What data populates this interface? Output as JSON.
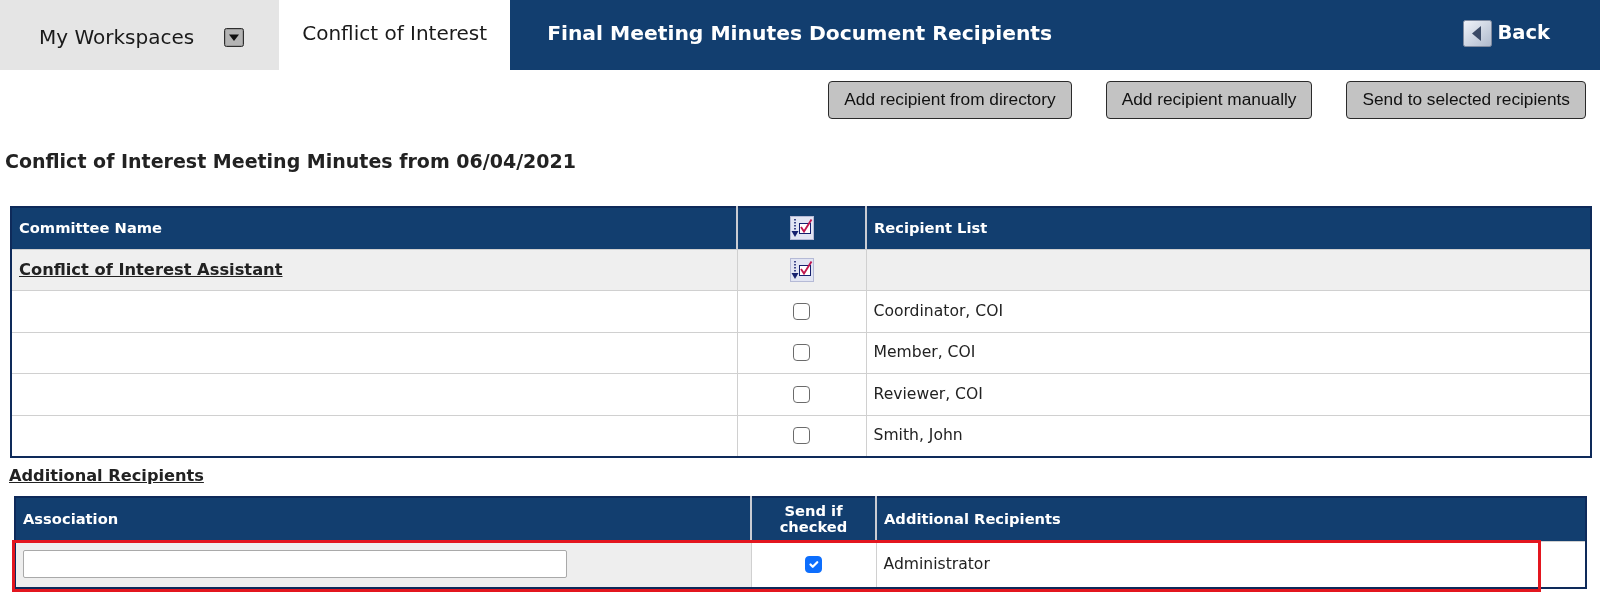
{
  "tabs": [
    {
      "label": "My Workspaces",
      "selected": false,
      "kind": "dropdown"
    },
    {
      "label": "Conflict of Interest",
      "selected": true,
      "kind": "plain"
    }
  ],
  "title_bar": {
    "title": "Final Meeting Minutes Document Recipients",
    "back": "Back"
  },
  "actions": [
    "Add recipient from directory",
    "Add recipient manually",
    "Send to selected recipients"
  ],
  "heading": "Conflict of Interest Meeting Minutes from 06/04/2021",
  "recipients_table": {
    "columns": [
      {
        "kind": "text",
        "label": "Committee Name"
      },
      {
        "kind": "icon"
      },
      {
        "kind": "text",
        "label": "Recipient List"
      }
    ],
    "groups": [
      {
        "name": "Conflict of Interest Assistant",
        "rows": [
          {
            "recipient": "Coordinator, COI",
            "checked": false
          },
          {
            "recipient": "Member, COI",
            "checked": false
          },
          {
            "recipient": "Reviewer, COI",
            "checked": false
          },
          {
            "recipient": "Smith, John",
            "checked": false
          }
        ]
      }
    ]
  },
  "additional_link": "Additional Recipients",
  "additional_table": {
    "columns": [
      "Association",
      "Send if checked",
      "Additional Recipients"
    ],
    "rows": [
      {
        "recipient": "Administrator",
        "checked": true,
        "highlighted": true
      }
    ]
  }
}
